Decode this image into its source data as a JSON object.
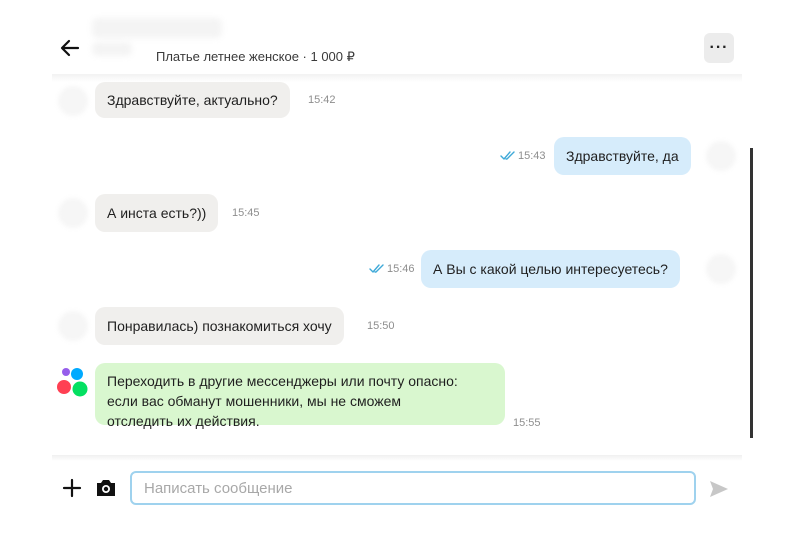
{
  "header": {
    "item_title": "Платье летнее женское · 1 000 ₽",
    "back_icon": "arrow-left-icon",
    "more_label": "···"
  },
  "messages": [
    {
      "direction": "incoming",
      "text": "Здравствуйте, актуально?",
      "time": "15:42"
    },
    {
      "direction": "outgoing",
      "text": "Здравствуйте, да",
      "time": "15:43",
      "status": "read"
    },
    {
      "direction": "incoming",
      "text": "А инста есть?))",
      "time": "15:45"
    },
    {
      "direction": "outgoing",
      "text": "А Вы с какой целью интересуетесь?",
      "time": "15:46",
      "status": "read"
    },
    {
      "direction": "incoming",
      "text": "Понравилась) познакомиться хочу",
      "time": "15:50"
    },
    {
      "direction": "system",
      "lines": [
        "Переходить в другие мессенджеры или почту опасно:",
        "если вас обманут мошенники, мы не сможем",
        "отследить их действия."
      ],
      "time": "15:55"
    }
  ],
  "composer": {
    "placeholder": "Написать сообщение",
    "value": ""
  },
  "colors": {
    "incoming_bubble": "#f0efed",
    "outgoing_bubble": "#d6ecfb",
    "system_bubble": "#d9f7cf",
    "read_check": "#3fa9d8",
    "input_border": "#9fd2ee"
  }
}
